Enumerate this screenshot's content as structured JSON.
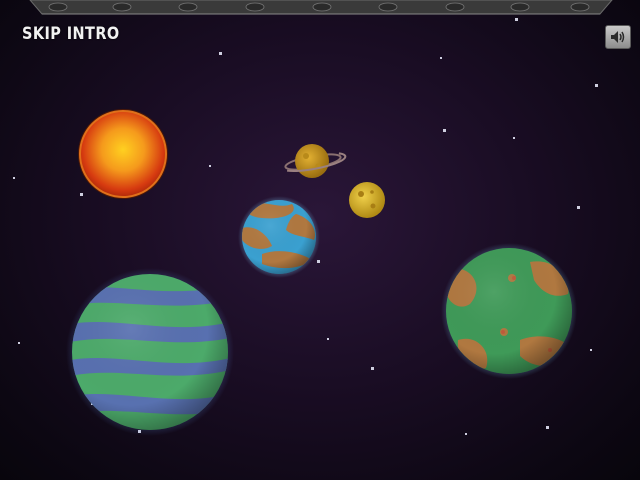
{
  "skip_intro": {
    "label": "SKIP INTRO"
  },
  "sound": {
    "icon": "speaker-volume-icon"
  },
  "colors": {
    "background": "#1a0d24",
    "sun": "#f2a020",
    "earth_ocean": "#3aa0d0",
    "earth_land": "#b07840",
    "gas_giant_green": "#4caa6a",
    "gas_giant_blue": "#5a6ab8",
    "green_planet": "#3f9a58",
    "moon": "#e0c040"
  }
}
